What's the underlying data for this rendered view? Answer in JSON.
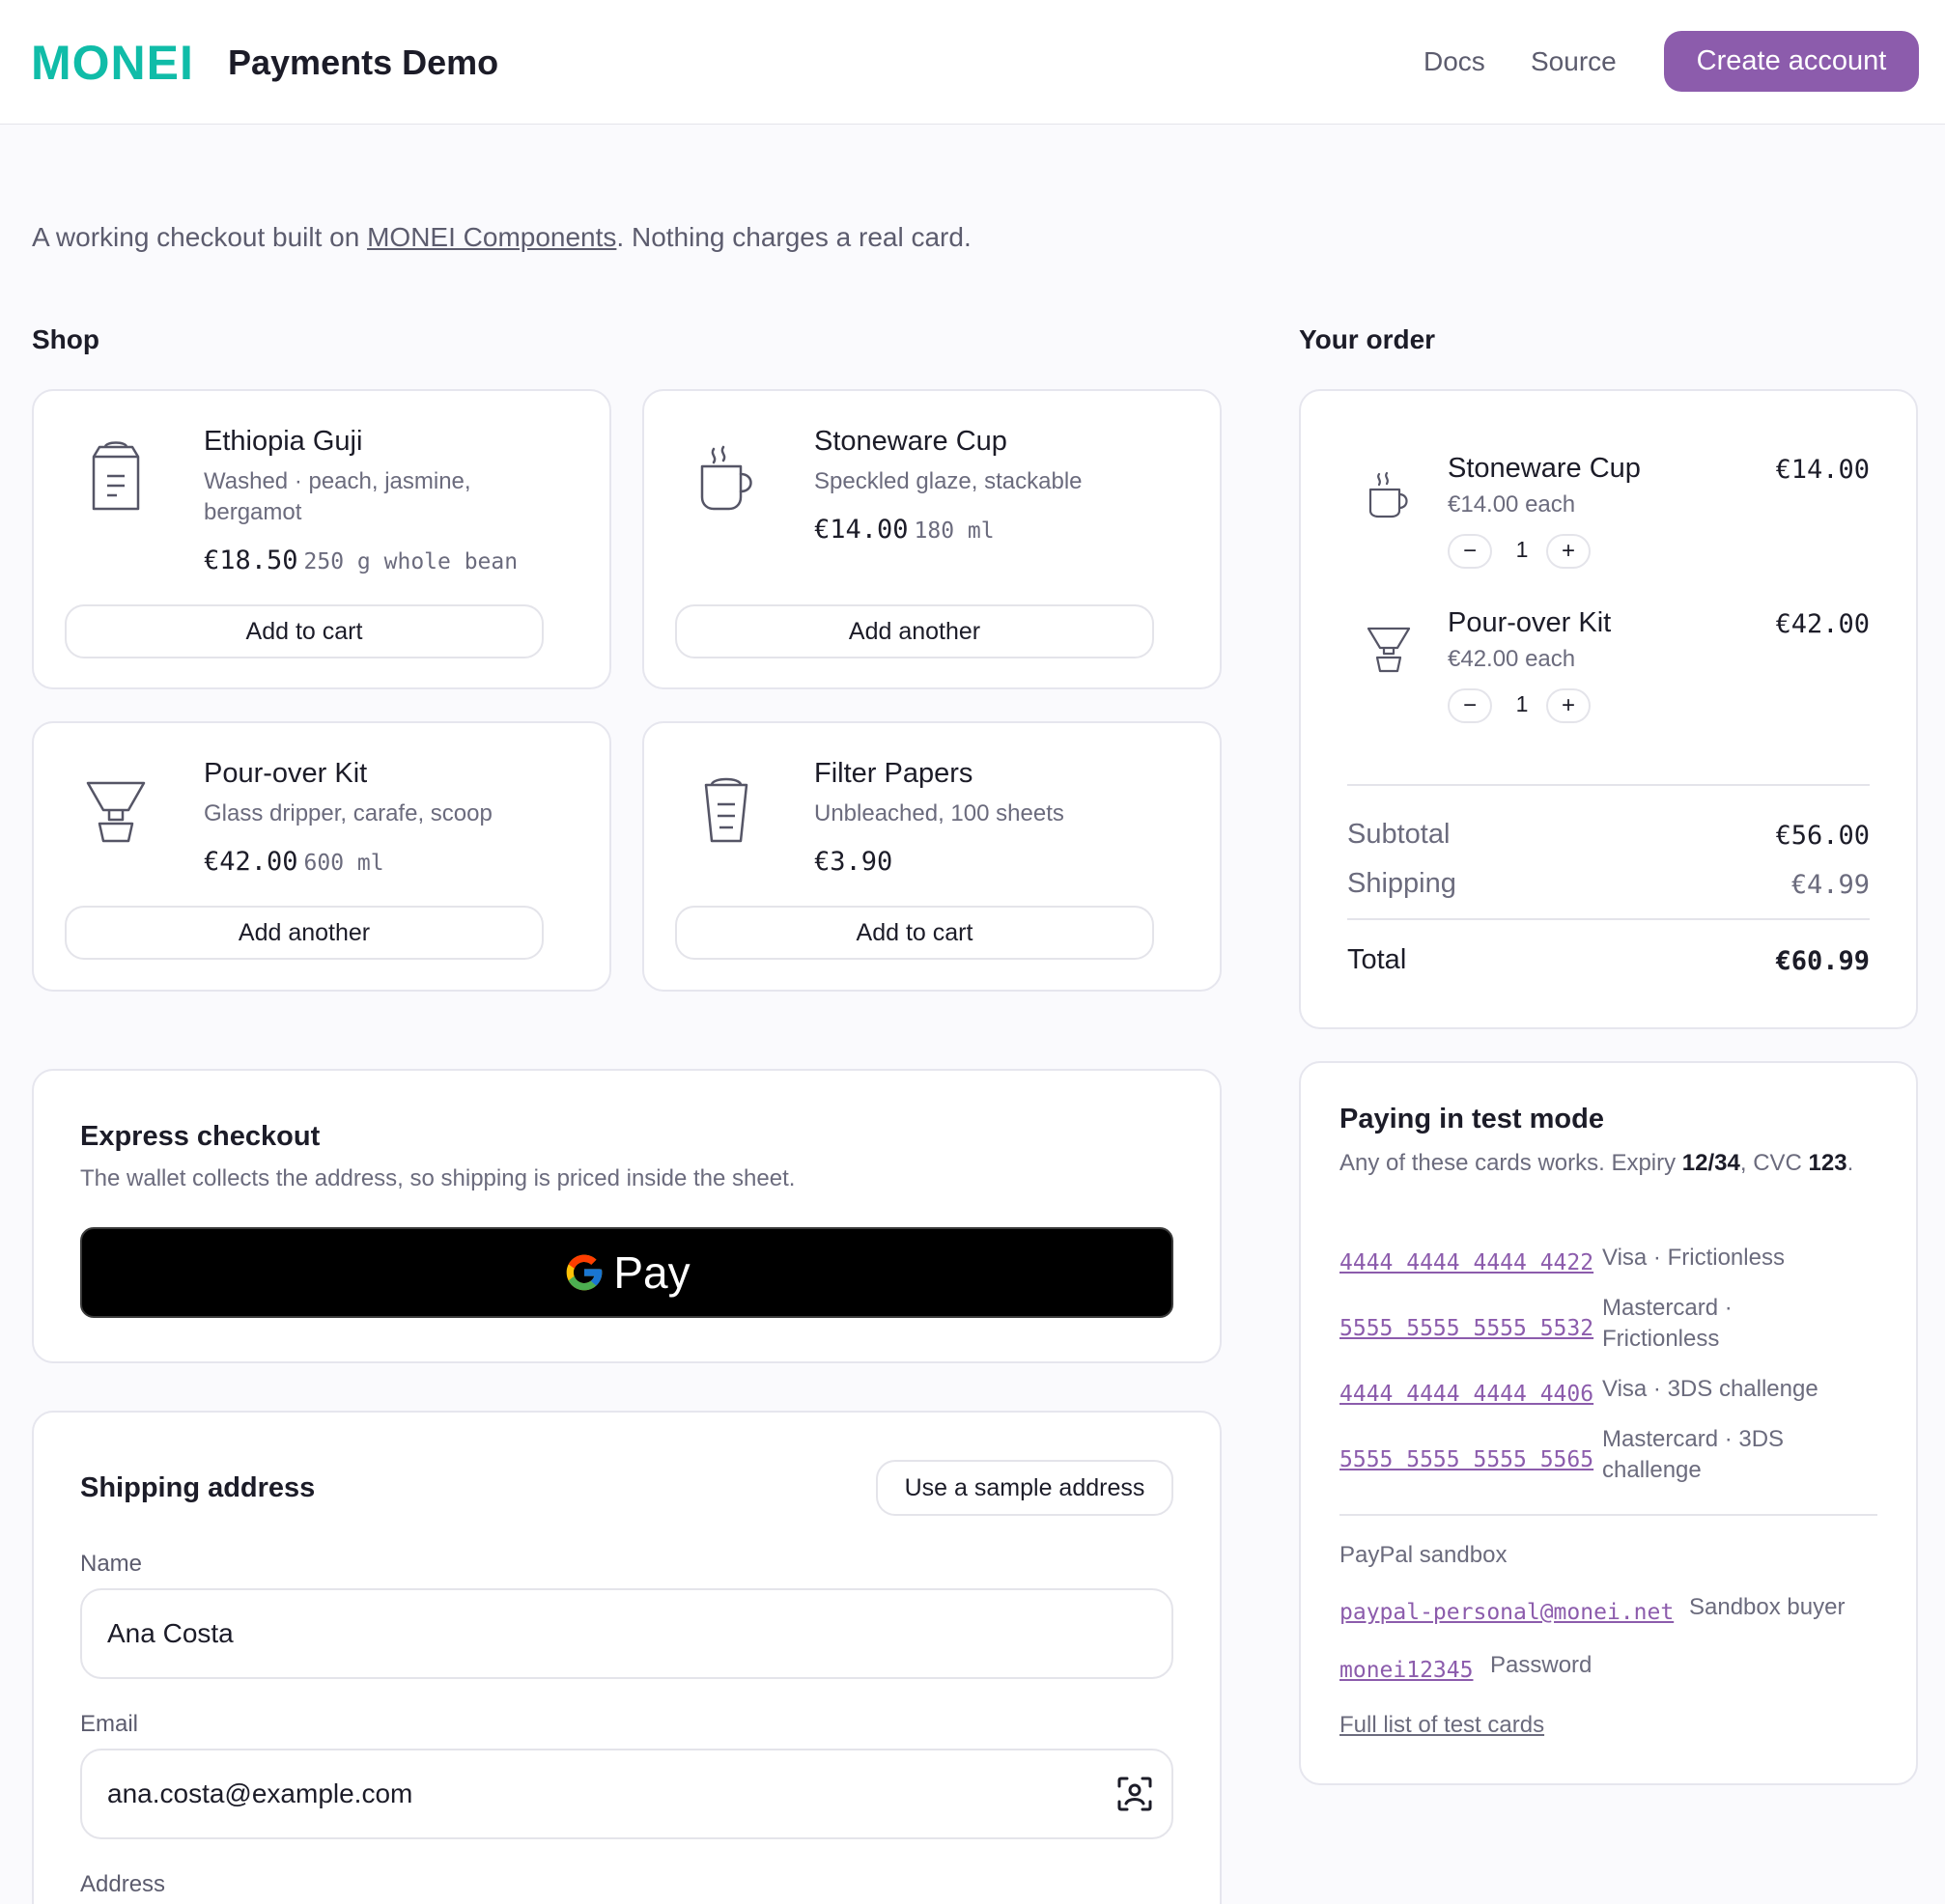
{
  "header": {
    "logo": "MONEI",
    "title": "Payments Demo",
    "nav": {
      "docs": "Docs",
      "source": "Source"
    },
    "cta": "Create account"
  },
  "intro": {
    "before": "A working checkout built on ",
    "link": "MONEI Components",
    "after": ". Nothing charges a real card."
  },
  "shop": {
    "title": "Shop",
    "products": [
      {
        "name": "Ethiopia Guji",
        "desc": "Washed · peach, jasmine, bergamot",
        "price": "€18.50",
        "unit": "250 g whole bean",
        "button": "Add to cart",
        "icon": "coffee-bag-icon"
      },
      {
        "name": "Stoneware Cup",
        "desc": "Speckled glaze, stackable",
        "price": "€14.00",
        "unit": "180 ml",
        "button": "Add another",
        "icon": "cup-icon"
      },
      {
        "name": "Pour-over Kit",
        "desc": "Glass dripper, carafe, scoop",
        "price": "€42.00",
        "unit": "600 ml",
        "button": "Add another",
        "icon": "dripper-icon"
      },
      {
        "name": "Filter Papers",
        "desc": "Unbleached, 100 sheets",
        "price": "€3.90",
        "unit": "",
        "button": "Add to cart",
        "icon": "filter-icon"
      }
    ]
  },
  "order": {
    "title": "Your order",
    "items": [
      {
        "name": "Stoneware Cup",
        "each": "€14.00 each",
        "qty": "1",
        "total": "€14.00",
        "icon": "cup-icon"
      },
      {
        "name": "Pour-over Kit",
        "each": "€42.00 each",
        "qty": "1",
        "total": "€42.00",
        "icon": "dripper-icon"
      }
    ],
    "qty_minus": "−",
    "qty_plus": "+",
    "subtotal_label": "Subtotal",
    "subtotal": "€56.00",
    "shipping_label": "Shipping",
    "shipping": "€4.99",
    "total_label": "Total",
    "total": "€60.99"
  },
  "express": {
    "title": "Express checkout",
    "subtitle": "The wallet collects the address, so shipping is priced inside the sheet.",
    "gpay_label": "Pay"
  },
  "shipping": {
    "title": "Shipping address",
    "sample_button": "Use a sample address",
    "name_label": "Name",
    "name_value": "Ana Costa",
    "email_label": "Email",
    "email_value": "ana.costa@example.com",
    "address_label": "Address"
  },
  "test": {
    "title": "Paying in test mode",
    "sub_before": "Any of these cards works. Expiry ",
    "expiry": "12/34",
    "sub_mid": ", CVC ",
    "cvc": "123",
    "sub_after": ".",
    "cards": [
      {
        "number": "4444 4444 4444 4422",
        "desc": "Visa · Frictionless"
      },
      {
        "number": "5555 5555 5555 5532",
        "desc": "Mastercard · Frictionless"
      },
      {
        "number": "4444 4444 4444 4406",
        "desc": "Visa · 3DS challenge"
      },
      {
        "number": "5555 5555 5555 5565",
        "desc": "Mastercard · 3DS challenge"
      }
    ],
    "paypal_title": "PayPal sandbox",
    "paypal": [
      {
        "value": "paypal-personal@monei.net",
        "desc": "Sandbox buyer"
      },
      {
        "value": "monei12345",
        "desc": "Password"
      }
    ],
    "full_list": "Full list of test cards"
  },
  "colors": {
    "brand": "#10bca8",
    "accent": "#8c5cac",
    "text": "#1c1c28",
    "muted": "#6b6b7d"
  }
}
